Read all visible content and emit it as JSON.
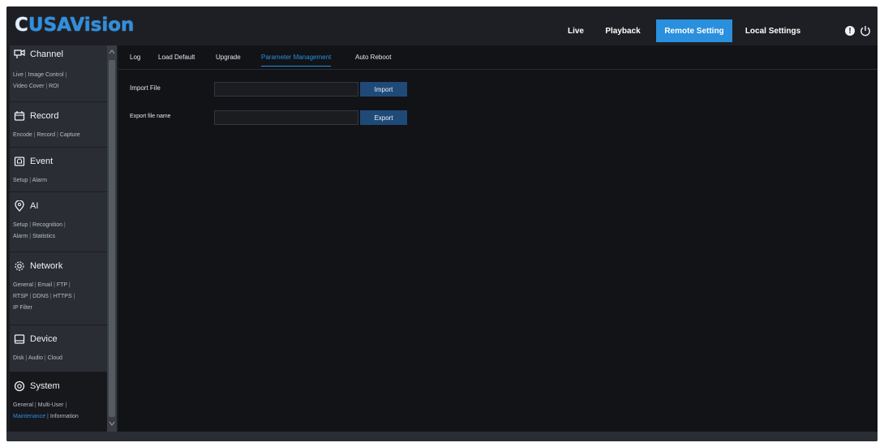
{
  "app": {
    "logo_text": "USAVision",
    "accent_color": "#2a8fdd"
  },
  "topnav": {
    "items": [
      {
        "label": "Live"
      },
      {
        "label": "Playback"
      },
      {
        "label": "Remote Setting",
        "active": true
      },
      {
        "label": "Local Settings"
      }
    ],
    "info_icon": "info-icon",
    "power_icon": "power-icon"
  },
  "sidebar": {
    "groups": [
      {
        "title": "Channel",
        "icon": "channel-icon",
        "links": [
          "Live",
          "Image Control",
          "Video Cover",
          "ROI"
        ]
      },
      {
        "title": "Record",
        "icon": "record-icon",
        "links": [
          "Encode",
          "Record",
          "Capture"
        ]
      },
      {
        "title": "Event",
        "icon": "event-icon",
        "links": [
          "Setup",
          "Alarm"
        ]
      },
      {
        "title": "AI",
        "icon": "ai-icon",
        "links": [
          "Setup",
          "Recognition",
          "Alarm",
          "Statistics"
        ]
      },
      {
        "title": "Network",
        "icon": "network-icon",
        "links": [
          "General",
          "Email",
          "FTP",
          "RTSP",
          "DDNS",
          "HTTPS",
          "IP Filter"
        ]
      },
      {
        "title": "Device",
        "icon": "device-icon",
        "links": [
          "Disk",
          "Audio",
          "Cloud"
        ]
      },
      {
        "title": "System",
        "icon": "system-icon",
        "links": [
          "General",
          "Multi-User",
          "Maintenance",
          "Information"
        ],
        "active": true,
        "selected_link": "Maintenance"
      }
    ]
  },
  "main": {
    "tabs": [
      {
        "label": "Log"
      },
      {
        "label": "Load Default"
      },
      {
        "label": "Upgrade"
      },
      {
        "label": "Parameter Management",
        "active": true
      },
      {
        "label": "Auto Reboot"
      }
    ],
    "import_label": "Import File",
    "import_value": "",
    "import_button": "Import",
    "export_label": "Export file name",
    "export_value": "",
    "export_button": "Export"
  }
}
